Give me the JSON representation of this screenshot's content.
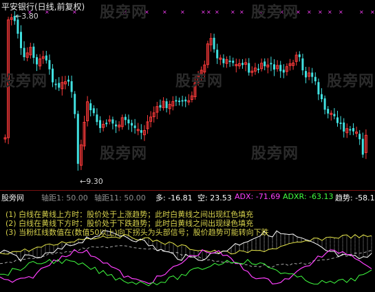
{
  "window": {
    "title": "平安银行(日线,前复权)"
  },
  "price_chart": {
    "high_label": "3.80",
    "low_label": "9.30",
    "colors": {
      "up": "#ff3b3b",
      "down": "#41e1e1",
      "marker": "#ff40ff"
    }
  },
  "watermarks": {
    "text": "股旁网"
  },
  "indicator": {
    "name": "股旁网",
    "fields": [
      {
        "label": "轴距1: 50.00",
        "color": "#8e8e8e"
      },
      {
        "label": "轴距11: 50.00",
        "color": "#8e8e8e"
      },
      {
        "label": "多: -16.81",
        "color": "#ffffff"
      },
      {
        "label": "空: 23.53",
        "color": "#ffffff"
      },
      {
        "label": "ADX: -71.69",
        "color": "#ff40ff"
      },
      {
        "label": "ADXR: -63.13",
        "color": "#40ff40"
      },
      {
        "label": "趋势: -58.1",
        "color": "#ffffff"
      }
    ],
    "descriptions": [
      "(1) 白线在黄线上方时：股价处于上涨趋势；此时白黄线之间出现红色填充",
      "(2) 白线在黄线下方时：股价处于下跌趋势；此时白黄线之间出现绿色填充",
      "(3) 当粉红线数值在(数值50以上)向下拐头为头部信号；股价趋势可能转向下跌"
    ],
    "colors": {
      "white_line": "#ffffff",
      "yellow_line": "#e8e84a",
      "pink_line": "#ff40ff",
      "green_line": "#40ff40",
      "dashed": "#aaaaaa"
    }
  }
}
